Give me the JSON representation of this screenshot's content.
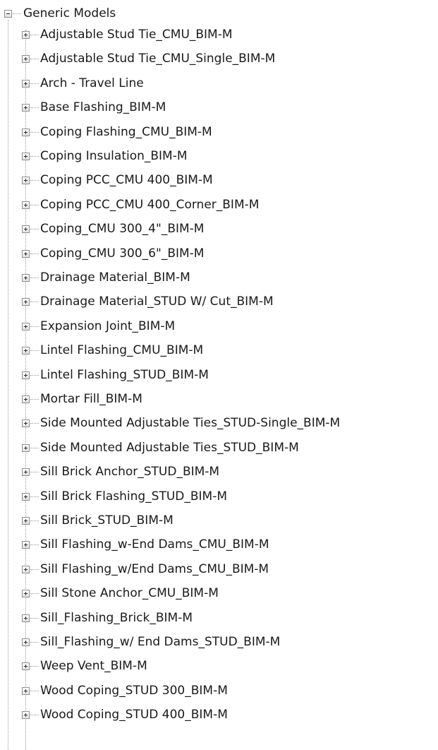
{
  "tree": {
    "root": {
      "label": "Generic Models",
      "expanded": true,
      "children": [
        {
          "label": "Adjustable Stud Tie_CMU_BIM-M"
        },
        {
          "label": "Adjustable Stud Tie_CMU_Single_BIM-M"
        },
        {
          "label": "Arch - Travel Line"
        },
        {
          "label": "Base Flashing_BIM-M"
        },
        {
          "label": "Coping Flashing_CMU_BIM-M"
        },
        {
          "label": "Coping Insulation_BIM-M"
        },
        {
          "label": "Coping PCC_CMU 400_BIM-M"
        },
        {
          "label": "Coping PCC_CMU 400_Corner_BIM-M"
        },
        {
          "label": "Coping_CMU 300_4\"_BIM-M"
        },
        {
          "label": "Coping_CMU 300_6\"_BIM-M"
        },
        {
          "label": "Drainage Material_BIM-M"
        },
        {
          "label": "Drainage Material_STUD W/ Cut_BIM-M"
        },
        {
          "label": "Expansion Joint_BIM-M"
        },
        {
          "label": "Lintel Flashing_CMU_BIM-M"
        },
        {
          "label": "Lintel Flashing_STUD_BIM-M"
        },
        {
          "label": "Mortar Fill_BIM-M"
        },
        {
          "label": "Side Mounted Adjustable Ties_STUD-Single_BIM-M"
        },
        {
          "label": "Side Mounted Adjustable Ties_STUD_BIM-M"
        },
        {
          "label": "Sill Brick Anchor_STUD_BIM-M"
        },
        {
          "label": "Sill Brick Flashing_STUD_BIM-M"
        },
        {
          "label": "Sill Brick_STUD_BIM-M"
        },
        {
          "label": "Sill Flashing_w-End Dams_CMU_BIM-M"
        },
        {
          "label": "Sill Flashing_w/End Dams_CMU_BIM-M"
        },
        {
          "label": "Sill Stone Anchor_CMU_BIM-M"
        },
        {
          "label": "Sill_Flashing_Brick_BIM-M"
        },
        {
          "label": "Sill_Flashing_w/ End Dams_STUD_BIM-M"
        },
        {
          "label": "Weep Vent_BIM-M"
        },
        {
          "label": "Wood Coping_STUD 300_BIM-M"
        },
        {
          "label": "Wood Coping_STUD 400_BIM-M"
        }
      ]
    },
    "line_color": "#9a9a9a",
    "text_color": "#1a1a1a"
  }
}
